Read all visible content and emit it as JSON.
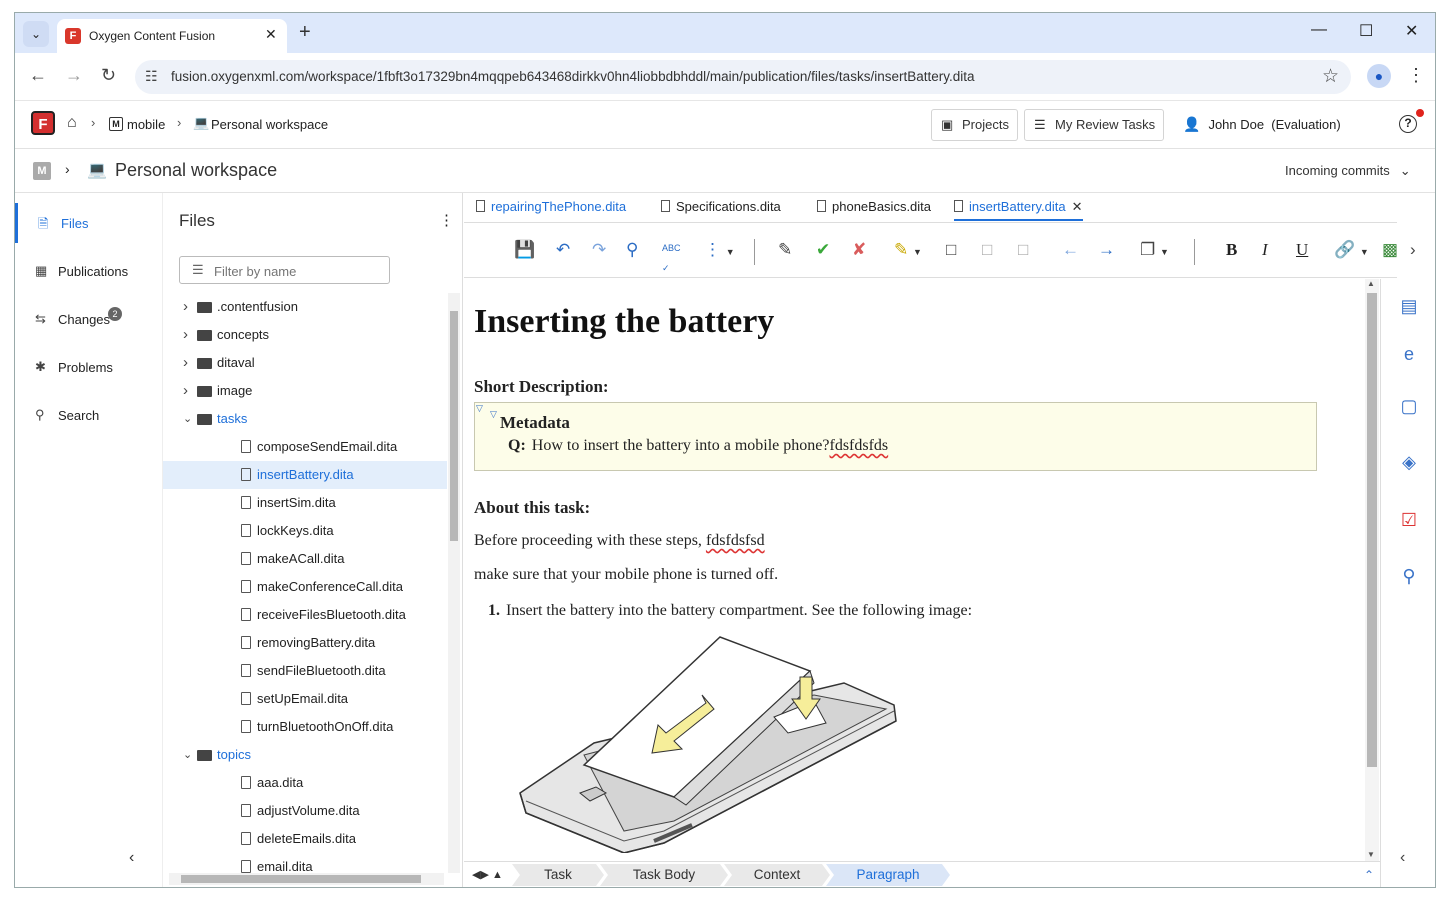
{
  "browser": {
    "tab_title": "Oxygen Content Fusion",
    "url": "fusion.oxygenxml.com/workspace/1fbft3o17329bn4mqqpeb643468dirkkv0hn4liobbdbhddl/main/publication/files/tasks/insertBattery.dita"
  },
  "header": {
    "breadcrumb": [
      "mobile",
      "Personal workspace"
    ],
    "projects_label": "Projects",
    "review_label": "My Review Tasks",
    "user_label": "John Doe  (Evaluation)"
  },
  "workspace": {
    "title": "Personal workspace",
    "incoming_label": "Incoming commits"
  },
  "leftnav": {
    "items": [
      {
        "label": "Files",
        "icon": "file-icon"
      },
      {
        "label": "Publications",
        "icon": "publications-icon"
      },
      {
        "label": "Changes",
        "icon": "changes-icon",
        "badge": "2"
      },
      {
        "label": "Problems",
        "icon": "bug-icon"
      },
      {
        "label": "Search",
        "icon": "search-icon"
      }
    ]
  },
  "files": {
    "title": "Files",
    "filter_placeholder": "Filter by name",
    "tree": [
      {
        "label": ".contentfusion",
        "type": "folder",
        "depth": 0,
        "expanded": false
      },
      {
        "label": "concepts",
        "type": "folder",
        "depth": 0,
        "expanded": false
      },
      {
        "label": "ditaval",
        "type": "folder",
        "depth": 0,
        "expanded": false
      },
      {
        "label": "image",
        "type": "folder",
        "depth": 0,
        "expanded": false
      },
      {
        "label": "tasks",
        "type": "folder",
        "depth": 0,
        "expanded": true
      },
      {
        "label": "composeSendEmail.dita",
        "type": "file",
        "depth": 1
      },
      {
        "label": "insertBattery.dita",
        "type": "file",
        "depth": 1,
        "selected": true
      },
      {
        "label": "insertSim.dita",
        "type": "file",
        "depth": 1
      },
      {
        "label": "lockKeys.dita",
        "type": "file",
        "depth": 1
      },
      {
        "label": "makeACall.dita",
        "type": "file",
        "depth": 1
      },
      {
        "label": "makeConferenceCall.dita",
        "type": "file",
        "depth": 1
      },
      {
        "label": "receiveFilesBluetooth.dita",
        "type": "file",
        "depth": 1
      },
      {
        "label": "removingBattery.dita",
        "type": "file",
        "depth": 1
      },
      {
        "label": "sendFileBluetooth.dita",
        "type": "file",
        "depth": 1
      },
      {
        "label": "setUpEmail.dita",
        "type": "file",
        "depth": 1
      },
      {
        "label": "turnBluetoothOnOff.dita",
        "type": "file",
        "depth": 1
      },
      {
        "label": "topics",
        "type": "folder",
        "depth": 0,
        "expanded": true
      },
      {
        "label": "aaa.dita",
        "type": "file",
        "depth": 1
      },
      {
        "label": "adjustVolume.dita",
        "type": "file",
        "depth": 1
      },
      {
        "label": "deleteEmails.dita",
        "type": "file",
        "depth": 1
      },
      {
        "label": "email.dita",
        "type": "file",
        "depth": 1
      }
    ]
  },
  "editor": {
    "tabs": [
      {
        "label": "repairingThePhone.dita",
        "active": false
      },
      {
        "label": "Specifications.dita",
        "active": false
      },
      {
        "label": "phoneBasics.dita",
        "active": false
      },
      {
        "label": "insertBattery.dita",
        "active": true
      }
    ],
    "toolbar_icons": [
      "save-icon",
      "undo-icon",
      "redo-icon",
      "find-icon",
      "spellcheck-icon",
      "more-icon",
      "track-changes-icon",
      "accept-icon",
      "reject-icon",
      "highlight-icon",
      "add-comment-icon",
      "edit-comment-icon",
      "remove-comment-icon",
      "previous-icon",
      "next-icon",
      "paste-icon",
      "bold-icon",
      "italic-icon",
      "underline-icon",
      "link-icon",
      "image-icon"
    ],
    "toolbar_text": {
      "spell": "ABC",
      "bold": "B",
      "italic": "I",
      "underline": "U"
    },
    "doc": {
      "title": "Inserting the battery",
      "short_desc": "Short Description:",
      "metadata_label": "Metadata",
      "q_label": "Q:",
      "q_text": "How to insert the battery into a mobile phone?",
      "q_misspelled": "fdsfdsfds",
      "about_label": "About this task:",
      "p1_text": "Before proceeding with these steps, ",
      "p1_misspelled": "fdsfdsfsd",
      "p2_text": "make sure that your mobile phone is turned off.",
      "step_number": "1.",
      "step_text": "Insert the battery into the battery compartment. See the following image:"
    },
    "status_crumbs": [
      {
        "label": "Task",
        "active": false
      },
      {
        "label": "Task Body",
        "active": false
      },
      {
        "label": "Context",
        "active": false
      },
      {
        "label": "Paragraph",
        "active": true
      }
    ]
  },
  "rightbar_icons": [
    "outline-icon",
    "attributes-icon",
    "comments-icon",
    "tags-icon",
    "review-icon",
    "find-replace-icon"
  ],
  "colors": {
    "accent": "#1e6fd9",
    "browser_chrome": "#dde8fb",
    "metadata_bg": "#fdfde9",
    "logo": "#d32f2f"
  }
}
